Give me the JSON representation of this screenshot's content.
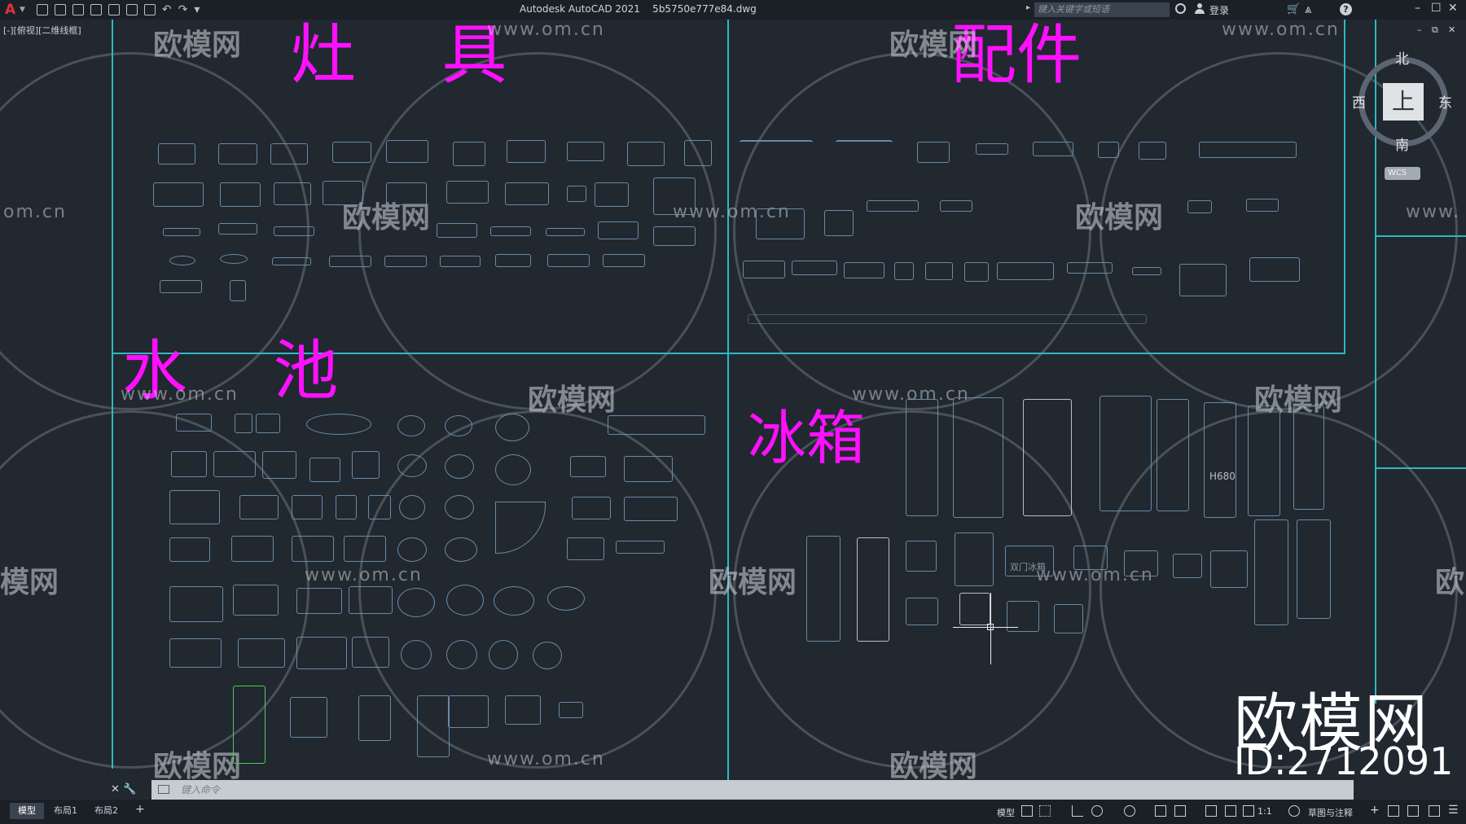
{
  "app": {
    "title": "Autodesk AutoCAD 2021    5b5750e777e84.dwg",
    "search_placeholder": "键入关键字或短语",
    "login_label": "登录",
    "view_label": "[-][俯视][二维线框]",
    "window_controls": {
      "minimize": "–",
      "maximize": "☐",
      "close": "✕"
    },
    "doc_controls": {
      "minimize": "–",
      "restore": "⧉",
      "close": "✕"
    }
  },
  "sections": {
    "stove": "灶 具",
    "accessories": "配件",
    "sink": "水 池",
    "fridge": "冰箱"
  },
  "watermark": {
    "brand": "欧模网",
    "url": "www.om.cn",
    "partial_url": "om.cn",
    "partial_url_right": "www.",
    "partial_brand_left": "模网",
    "partial_brand_right": "欧"
  },
  "drawing_labels": {
    "fridge_h": "H680",
    "fridge_double": "双门冰箱"
  },
  "viewcube": {
    "top": "上",
    "north": "北",
    "south": "南",
    "west": "西",
    "east": "东",
    "wcs": "WCS"
  },
  "brand": {
    "name": "欧模网",
    "id": "ID:2712091"
  },
  "command": {
    "placeholder": "键入命令"
  },
  "layout_tabs": [
    "模型",
    "布局1",
    "布局2"
  ],
  "statusbar": {
    "model_label": "模型",
    "scale": "1:1",
    "workspace": "草图与注释"
  },
  "colors": {
    "accent_cyan": "#2fb8c4",
    "title_magenta": "#ff10ff",
    "background": "#212830"
  }
}
